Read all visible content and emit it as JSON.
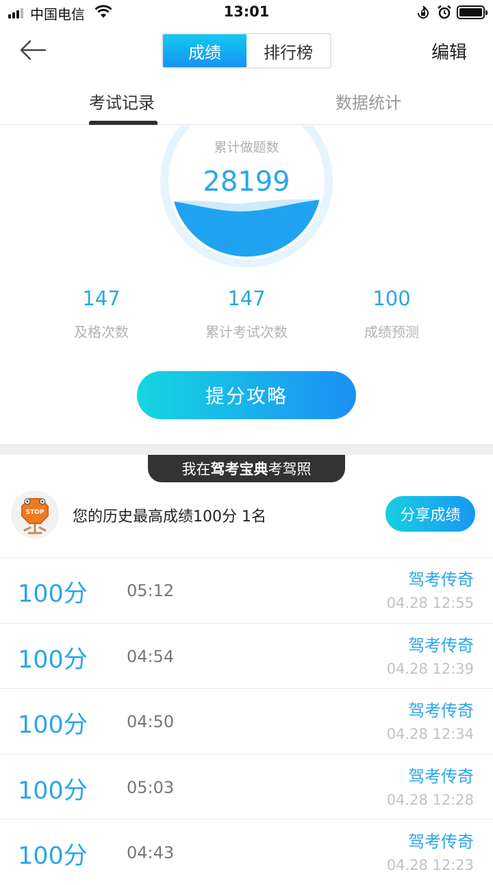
{
  "status_bar": {
    "carrier": "中国电信",
    "time": "13:01"
  },
  "nav": {
    "segments": [
      "成绩",
      "排行榜"
    ],
    "active_segment": "成绩",
    "edit_label": "编辑"
  },
  "subtabs": {
    "items": [
      "考试记录",
      "数据统计"
    ],
    "active": "考试记录"
  },
  "gauge": {
    "label": "累计做题数",
    "value": "28199"
  },
  "stats": [
    {
      "value": "147",
      "label": "及格次数"
    },
    {
      "value": "147",
      "label": "累计考试次数"
    },
    {
      "value": "100",
      "label": "成绩预测"
    }
  ],
  "tips_button": "提分攻略",
  "brand_banner": {
    "prefix": "我在",
    "brand": "驾考宝典",
    "suffix": "考驾照"
  },
  "best_score": {
    "text": "您的历史最高成绩100分 1名",
    "share_label": "分享成绩",
    "avatar_text": "STOP"
  },
  "records": [
    {
      "score": "100分",
      "duration": "05:12",
      "name": "驾考传奇",
      "time": "04.28 12:55"
    },
    {
      "score": "100分",
      "duration": "04:54",
      "name": "驾考传奇",
      "time": "04.28 12:39"
    },
    {
      "score": "100分",
      "duration": "04:50",
      "name": "驾考传奇",
      "time": "04.28 12:34"
    },
    {
      "score": "100分",
      "duration": "05:03",
      "name": "驾考传奇",
      "time": "04.28 12:28"
    },
    {
      "score": "100分",
      "duration": "04:43",
      "name": "驾考传奇",
      "time": "04.28 12:23"
    }
  ],
  "colors": {
    "accent": "#2aa6e8",
    "gradient_start": "#16d6e0",
    "gradient_end": "#1b8ff5"
  }
}
